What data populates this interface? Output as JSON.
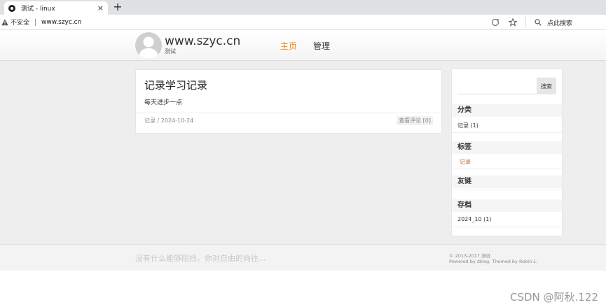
{
  "browser": {
    "tab_title": "测试 - linux",
    "tab_close": "×",
    "new_tab": "+",
    "insecure_label": "不安全",
    "url": "www.szyc.cn",
    "search_placeholder": "点此搜索"
  },
  "header": {
    "site_title": "www.szyc.cn",
    "site_subtitle": "测试",
    "nav": [
      {
        "label": "主页",
        "active": true,
        "color": "#f08a18"
      },
      {
        "label": "管理",
        "active": false
      }
    ]
  },
  "post": {
    "title": "记录学习记录",
    "excerpt": "每天进步一点",
    "meta": "记录 / 2024-10-24",
    "comments": "查看评论 [0]"
  },
  "sidebar": {
    "search_button": "搜索",
    "category_heading": "分类",
    "category_item": "记录 (1)",
    "tags_heading": "标签",
    "tag_item": "记录",
    "links_heading": "友链",
    "archive_heading": "存档",
    "archive_item": "2024_10 (1)"
  },
  "footer": {
    "slogan": "没有什么能够阻挡，你对自由的向往...",
    "copyright": "© 2013-2017 测试",
    "powered": "Powered by zblog. Themed by Robin L."
  },
  "watermark": "CSDN @阿秋.122"
}
